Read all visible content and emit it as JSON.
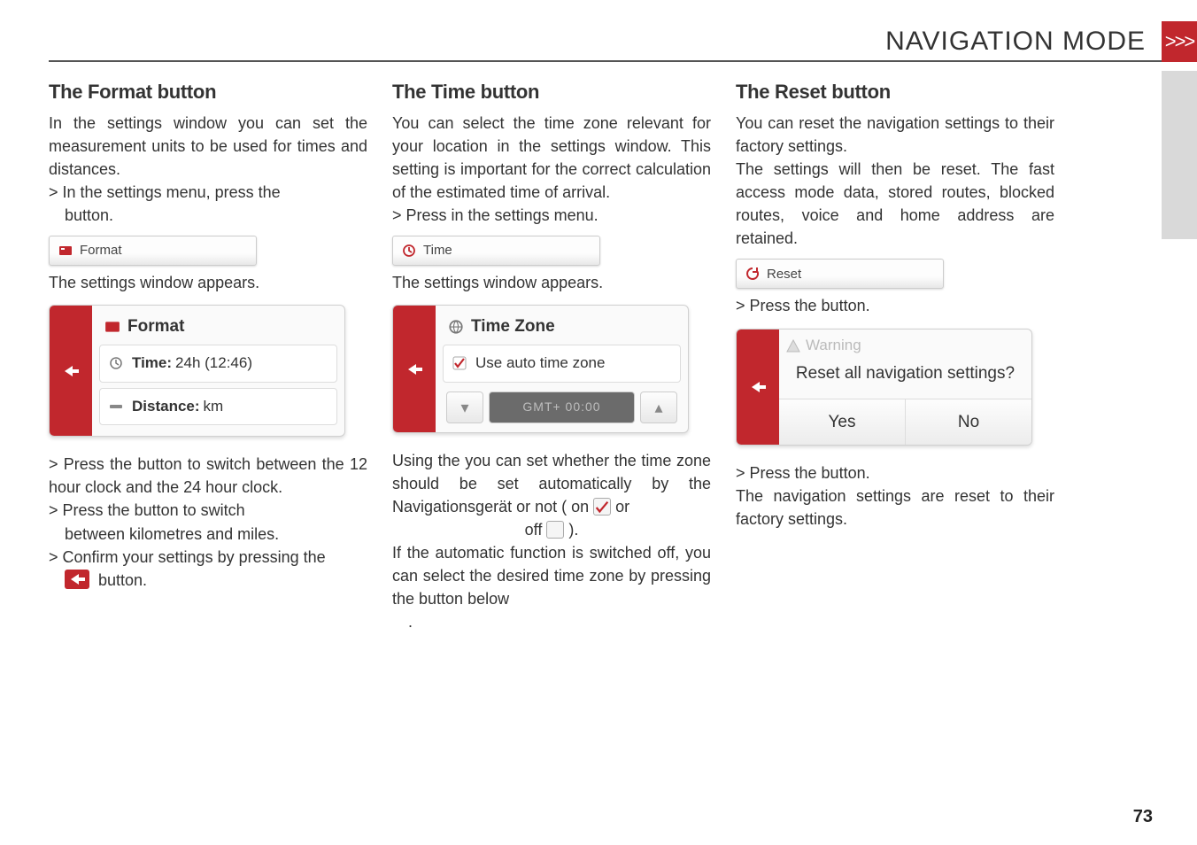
{
  "header": {
    "title": "NAVIGATION MODE",
    "chevrons": ">>>"
  },
  "col1": {
    "h": "The Format button",
    "p1a": "In the ",
    "p1b": " settings window you can set the measurement units to be used for times and distances.",
    "step1": "> In the settings menu, press the",
    "step1b": "button.",
    "btn_label": "Format",
    "line2a": "The ",
    "line2b": " settings window appears.",
    "panel": {
      "title": "Format",
      "row1_label": "Time:",
      "row1_val": "24h (12:46)",
      "row2_label": "Distance:",
      "row2_val": "km"
    },
    "step2": "> Press the          button to switch between the 12 hour clock and the 24 hour clock.",
    "step3a": "> Press the ",
    "step3b": " button to switch",
    "step3c": "between kilometres and miles.",
    "step4": "> Confirm your settings by pressing the",
    "step4b": "button."
  },
  "col2": {
    "h": "The Time button",
    "p1a": "You can select the time zone relevant for your location in the ",
    "p1b": " settings window. This setting is important for the correct calculation of the estimated time of arrival.",
    "step1": "> Press           in the settings menu.",
    "btn_label": "Time",
    "line2a": "The ",
    "line2b": " settings window appears.",
    "panel": {
      "title": "Time Zone",
      "row1": "Use auto time zone",
      "mid": "GMT+ 00:00"
    },
    "p2a": "Using the                  you can set whether the time zone should be set automatically by the Navigationsgerät or not (",
    "p2b": " on ",
    "p2c": " or",
    "p2d": "off ",
    "p2e": ").",
    "p3": "If the automatic function is switched off, you can select the desired time zone by pressing the button below",
    "p3b": "."
  },
  "col3": {
    "h": "The Reset button",
    "p1": "You can reset the navigation settings to their factory settings.",
    "p2": "The settings will then be reset. The fast access mode data, stored routes, blocked routes, voice and home address are retained.",
    "btn_label": "Reset",
    "step1": "> Press the           button.",
    "dialog": {
      "warn": "Warning",
      "msg": "Reset all navigation settings?",
      "yes": "Yes",
      "no": "No"
    },
    "step2": "> Press the        button.",
    "p3": "The navigation settings are reset to their factory settings."
  },
  "page_number": "73"
}
